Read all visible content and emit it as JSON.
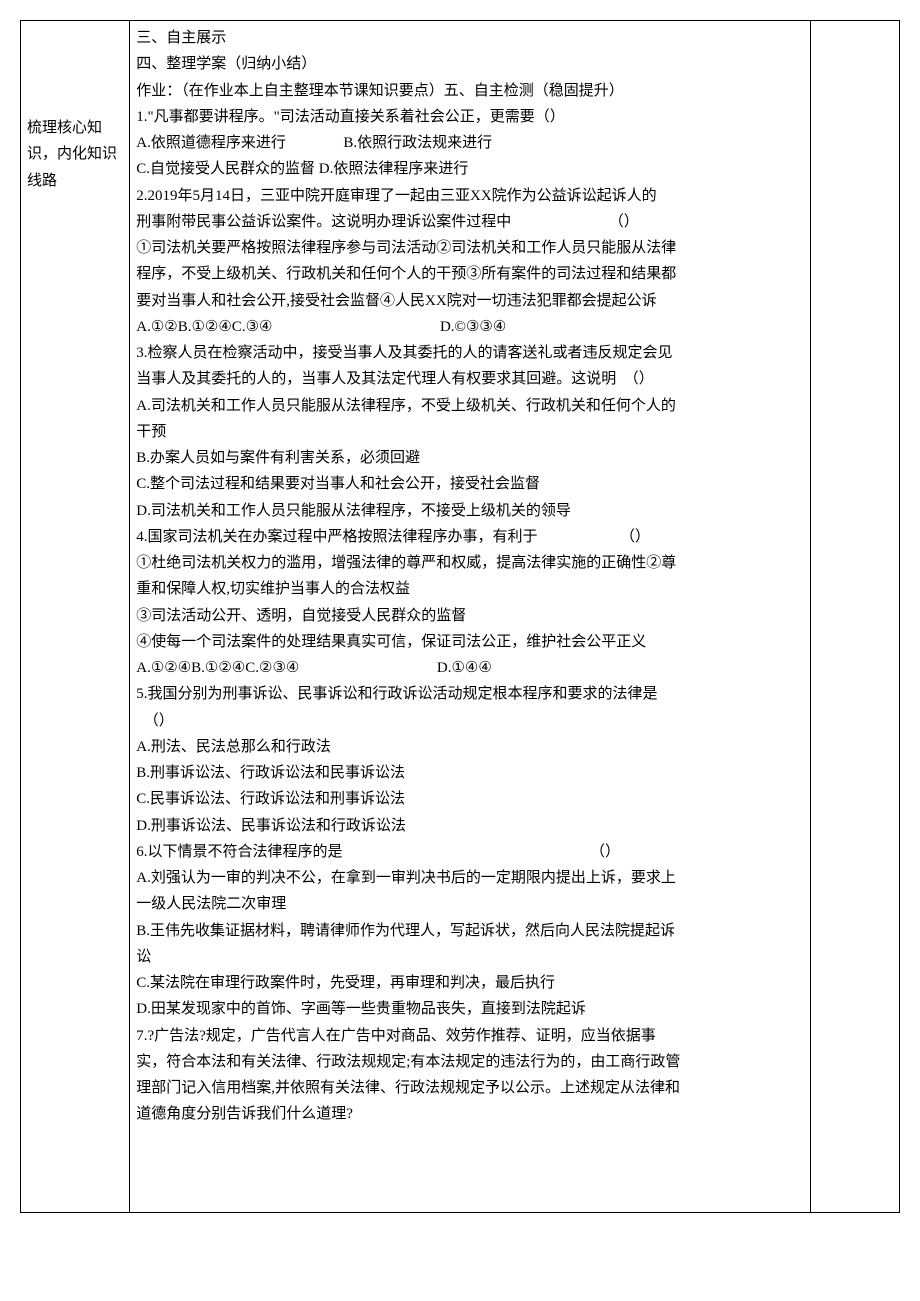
{
  "leftLabel": "梳理核心知识，内化知识线路",
  "body": {
    "h1": "三、自主展示",
    "h2": "四、整理学案（归纳小结）",
    "hw": "作业：（在作业本上自主整理本节课知识要点）五、自主检测（稳固提升）",
    "q1": {
      "stem": "1.\"凡事都要讲程序。\"司法活动直接关系着社会公正，更需要（）",
      "optA": "A.依照道德程序来进行",
      "optB": "B.依照行政法规来进行",
      "optC": "C.自觉接受人民群众的监督",
      "optD": "D.依照法律程序来进行"
    },
    "q2": {
      "l1": "2.2019年5月14日，三亚中院开庭审理了一起由三亚XX院作为公益诉讼起诉人的",
      "l2": "刑事附带民事公益诉讼案件。这说明办理诉讼案件过程中　　　　　　　（）",
      "l3": "①司法机关要严格按照法律程序参与司法活动②司法机关和工作人员只能服从法律",
      "l4": "程序，不受上级机关、行政机关和任何个人的干预③所有案件的司法过程和结果都",
      "l5": "要对当事人和社会公开,接受社会监督④人民XX院对一切违法犯罪都会提起公诉",
      "optABC": "A.①②B.①②④C.③④",
      "optD": "D.©③③④"
    },
    "q3": {
      "l1": "3.检察人员在检察活动中，接受当事人及其委托的人的请客送礼或者违反规定会见",
      "l2": "当事人及其委托的人的，当事人及其法定代理人有权要求其回避。这说明　（）",
      "a1": "A.司法机关和工作人员只能服从法律程序，不受上级机关、行政机关和任何个人的",
      "a2": "干预",
      "b": "B.办案人员如与案件有利害关系，必须回避",
      "c": "C.整个司法过程和结果要对当事人和社会公开，接受社会监督",
      "d": "D.司法机关和工作人员只能服从法律程序，不接受上级机关的领导"
    },
    "q4": {
      "l1": "4.国家司法机关在办案过程中严格按照法律程序办事，有利于　　　　　　（）",
      "l2": "①杜绝司法机关权力的滥用，增强法律的尊严和权威，提高法律实施的正确性②尊",
      "l3": "重和保障人权,切实维护当事人的合法权益",
      "l4": "③司法活动公开、透明，自觉接受人民群众的监督",
      "l5": "④使每一个司法案件的处理结果真实可信，保证司法公正，维护社会公平正义",
      "optABC": "A.①②④B.①②④C.②③④",
      "optD": "D.①④④"
    },
    "q5": {
      "l1": "5.我国分别为刑事诉讼、民事诉讼和行政诉讼活动规定根本程序和要求的法律是",
      "l2": "　（）",
      "a": "A.刑法、民法总那么和行政法",
      "b": "B.刑事诉讼法、行政诉讼法和民事诉讼法",
      "c": "C.民事诉讼法、行政诉讼法和刑事诉讼法",
      "d": "D.刑事诉讼法、民事诉讼法和行政诉讼法"
    },
    "q6": {
      "l1": "6.以下情景不符合法律程序的是　　　　　　　　　　　　　　　　　（）",
      "a1": "A.刘强认为一审的判决不公，在拿到一审判决书后的一定期限内提出上诉，要求上",
      "a2": "一级人民法院二次审理",
      "b1": "B.王伟先收集证据材料，聘请律师作为代理人，写起诉状，然后向人民法院提起诉",
      "b2": "讼",
      "c": "C.某法院在审理行政案件时，先受理，再审理和判决，最后执行",
      "d": "D.田某发现家中的首饰、字画等一些贵重物品丧失，直接到法院起诉"
    },
    "q7": {
      "l1": "7.?广告法?规定，广告代言人在广告中对商品、效劳作推荐、证明，应当依据事",
      "l2": "实，符合本法和有关法律、行政法规规定;有本法规定的违法行为的，由工商行政管",
      "l3": "理部门记入信用档案,并依照有关法律、行政法规规定予以公示。上述规定从法律和",
      "l4": "道德角度分别告诉我们什么道理?"
    }
  }
}
